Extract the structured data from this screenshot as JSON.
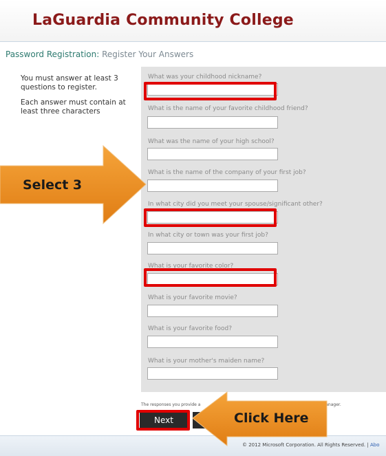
{
  "header": {
    "title": "LaGuardia Community College"
  },
  "breadcrumb": {
    "main": "Password Registration:",
    "sub": "Register Your Answers"
  },
  "instructions": {
    "line1": "You must answer at least 3 questions to register.",
    "line2": "Each answer must contain at least three characters"
  },
  "questions": [
    {
      "label": "What was your childhood nickname?",
      "value": ""
    },
    {
      "label": "What is the name of your favorite childhood friend?",
      "value": ""
    },
    {
      "label": "What was the name of your high school?",
      "value": ""
    },
    {
      "label": "What is the name of the company of your first job?",
      "value": ""
    },
    {
      "label": "In what city did you meet your spouse/significant other?",
      "value": ""
    },
    {
      "label": "In what city or town was your first job?",
      "value": ""
    },
    {
      "label": "What is your favorite color?",
      "value": ""
    },
    {
      "label": "What is your favorite movie?",
      "value": ""
    },
    {
      "label": "What is your favorite food?",
      "value": ""
    },
    {
      "label": "What is your mother's maiden name?",
      "value": ""
    }
  ],
  "footnote": {
    "start": "The responses you provide a",
    "end": "anager."
  },
  "buttons": {
    "next": "Next",
    "cancel": ""
  },
  "footer": {
    "copyright": "© 2012 Microsoft Corporation. All Rights Reserved.  |",
    "about": "Abo"
  },
  "annotations": {
    "left_arrow": "Select 3",
    "bottom_arrow": "Click Here",
    "arrow_color": "#e98a1e",
    "highlight_color": "#e00000"
  }
}
